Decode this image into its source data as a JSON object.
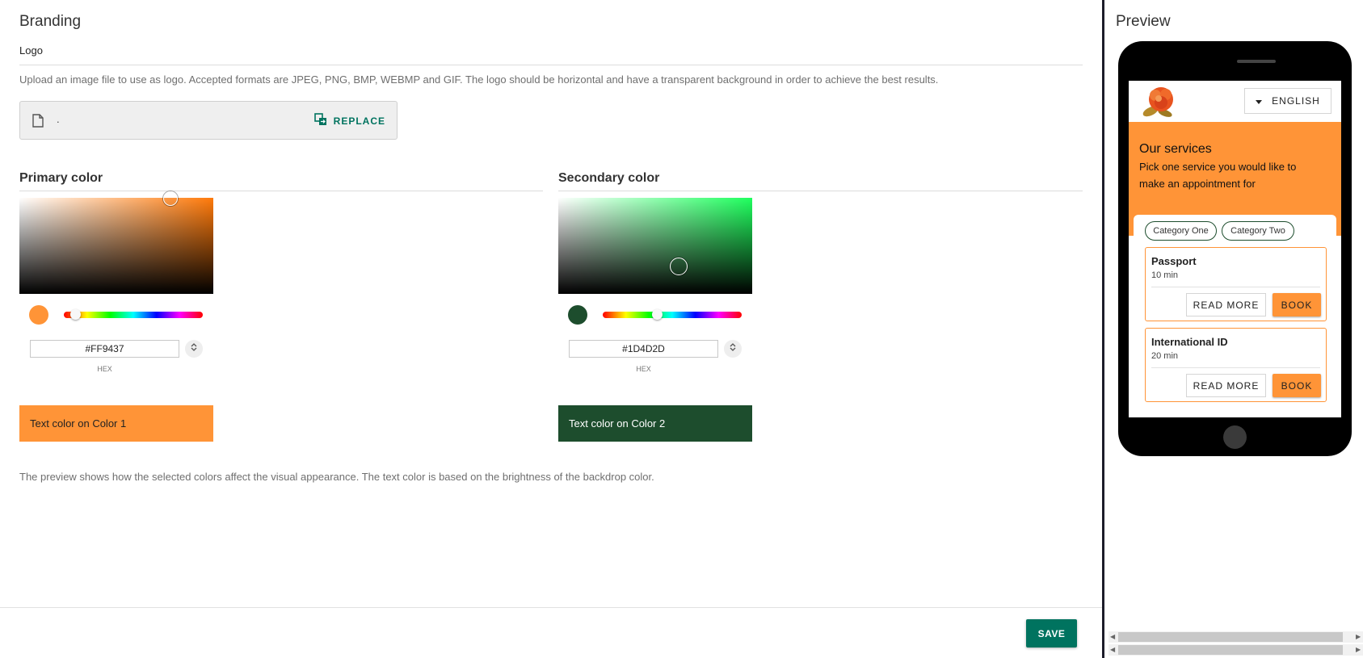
{
  "branding": {
    "title": "Branding",
    "logo_label": "Logo",
    "logo_help": "Upload an image file to use as logo. Accepted formats are JPEG, PNG, BMP, WEBMP and GIF. The logo should be horizontal and have a transparent background in order to achieve the best results.",
    "file_name": ".",
    "replace_label": "REPLACE"
  },
  "primary": {
    "title": "Primary color",
    "hex": "#FF9437",
    "hex_label": "HEX",
    "sample_text": "Text color on Color 1",
    "color": "#FF9437",
    "text_color": "#222222"
  },
  "secondary": {
    "title": "Secondary color",
    "hex": "#1D4D2D",
    "hex_label": "HEX",
    "sample_text": "Text color on Color 2",
    "color": "#1D4D2D",
    "text_color": "#ffffff"
  },
  "preview_note": "The preview shows how the selected colors affect the visual appearance. The text color is based on the brightness of the backdrop color.",
  "save_label": "SAVE",
  "preview": {
    "title": "Preview",
    "language": "ENGLISH",
    "services_title": "Our services",
    "services_subtitle": "Pick one service you would like to make an appointment for",
    "categories": [
      "Category One",
      "Category Two"
    ],
    "services": [
      {
        "name": "Passport",
        "duration": "10 min",
        "read_more": "READ MORE",
        "book": "BOOK"
      },
      {
        "name": "International ID",
        "duration": "20 min",
        "read_more": "READ MORE",
        "book": "BOOK"
      }
    ]
  },
  "icons": {
    "file": "file-icon",
    "replace": "replace-icon",
    "dropdown": "caret-down-icon",
    "spin": "unfold-icon",
    "logo": "flower-logo"
  }
}
